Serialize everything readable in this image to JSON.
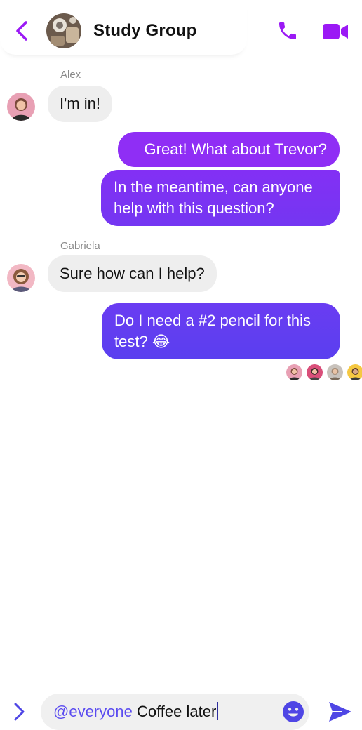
{
  "header": {
    "title": "Study Group",
    "back_icon": "chevron-left-icon",
    "call_icon": "phone-icon",
    "video_icon": "video-camera-icon"
  },
  "messages": [
    {
      "direction": "incoming",
      "sender": "Alex",
      "text": "I'm in!"
    },
    {
      "direction": "outgoing",
      "lines": [
        "Great! What about Trevor?"
      ]
    },
    {
      "direction": "outgoing",
      "lines": [
        "In the meantime, can anyone",
        "help with this question?"
      ]
    },
    {
      "direction": "incoming",
      "sender": "Gabriela",
      "text": "Sure how can I help?"
    },
    {
      "direction": "outgoing",
      "lines": [
        "Do I need a #2 pencil for this",
        "test? 😂"
      ]
    }
  ],
  "seen_by_count": 4,
  "composer": {
    "mention": "@everyone",
    "text": " Coffee later",
    "emoji_icon": "smiley-icon",
    "send_icon": "send-icon",
    "expand_icon": "chevron-right-icon"
  },
  "colors": {
    "accent": "#9b19f5",
    "bubble_out_top": "#8f2ef5",
    "bubble_out_bottom": "#5a3ff0",
    "bubble_in": "#eeeeee",
    "composer_icon": "#4f46e5"
  }
}
